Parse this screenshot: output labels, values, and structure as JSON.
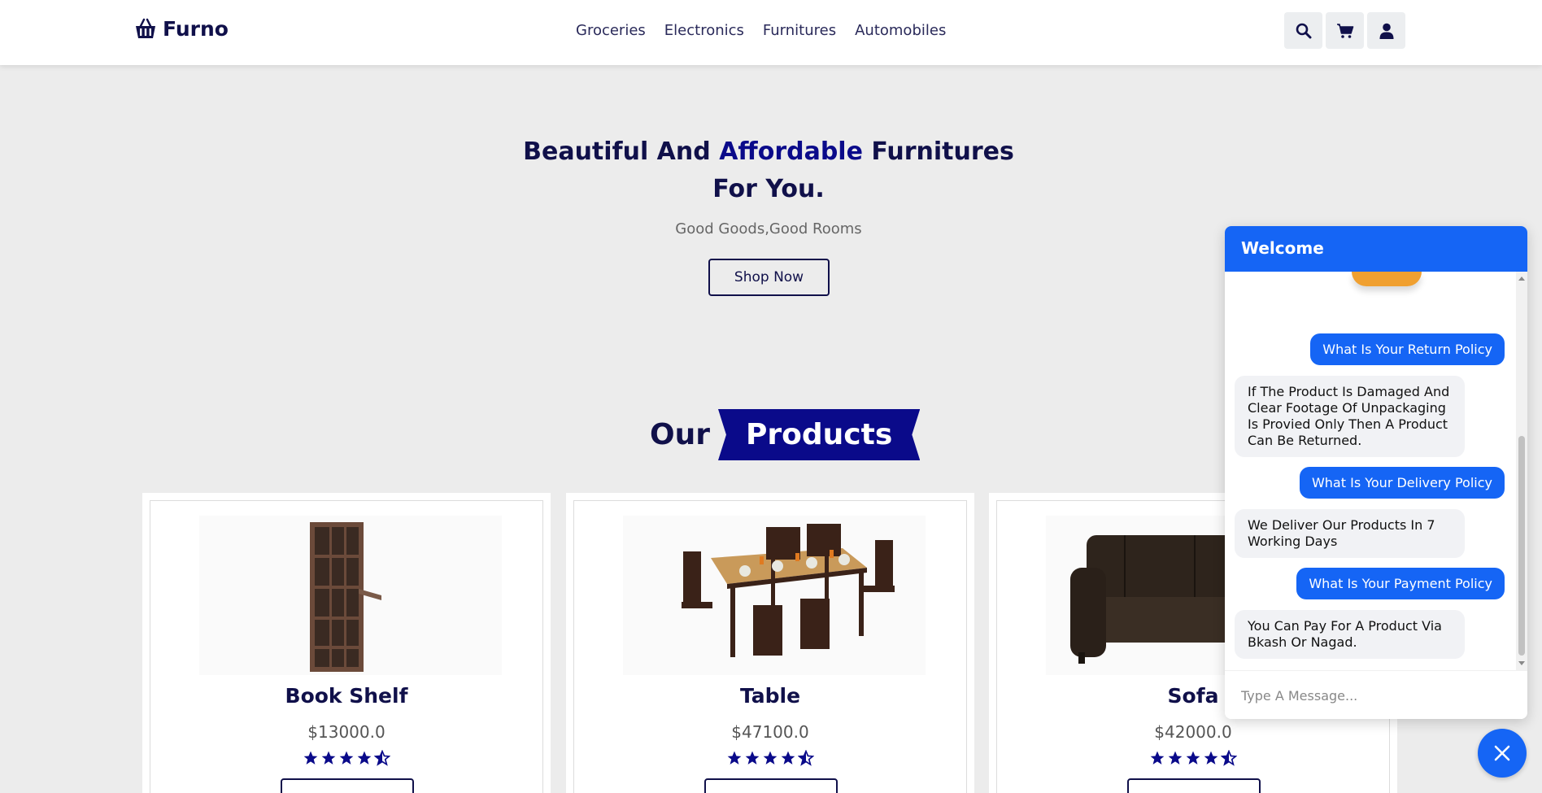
{
  "header": {
    "brand": "Furno",
    "nav": [
      "Groceries",
      "Electronics",
      "Furnitures",
      "Automobiles"
    ],
    "icons": [
      "search-icon",
      "cart-icon",
      "user-icon"
    ]
  },
  "hero": {
    "title_part1": "Beautiful And ",
    "title_accent": "Affordable",
    "title_part2": " Furnitures For You.",
    "subtitle": "Good Goods,Good Rooms",
    "cta": "Shop Now"
  },
  "section": {
    "our": "Our",
    "products": "Products"
  },
  "products": [
    {
      "name": "Book Shelf",
      "price": "$13000.0",
      "rating": 4.5
    },
    {
      "name": "Table",
      "price": "$47100.0",
      "rating": 4.5
    },
    {
      "name": "Sofa",
      "price": "$42000.0",
      "rating": 4.5
    }
  ],
  "chat": {
    "title": "Welcome",
    "messages": [
      {
        "from": "user",
        "text": "What Is Your Return Policy"
      },
      {
        "from": "bot",
        "text": "If The Product Is Damaged And Clear Footage Of Unpackaging Is Provied Only Then A Product Can Be Returned."
      },
      {
        "from": "user",
        "text": "What Is Your Delivery Policy"
      },
      {
        "from": "bot",
        "text": "We Deliver Our Products In 7 Working Days"
      },
      {
        "from": "user",
        "text": "What Is Your Payment Policy"
      },
      {
        "from": "bot",
        "text": "You Can Pay For A Product Via Bkash Or Nagad."
      }
    ],
    "input_placeholder": "Type A Message..."
  },
  "colors": {
    "brand_navy": "#10104a",
    "accent_blue": "#0a0a8a",
    "chat_blue": "#1565f5",
    "page_bg": "#ececec"
  }
}
